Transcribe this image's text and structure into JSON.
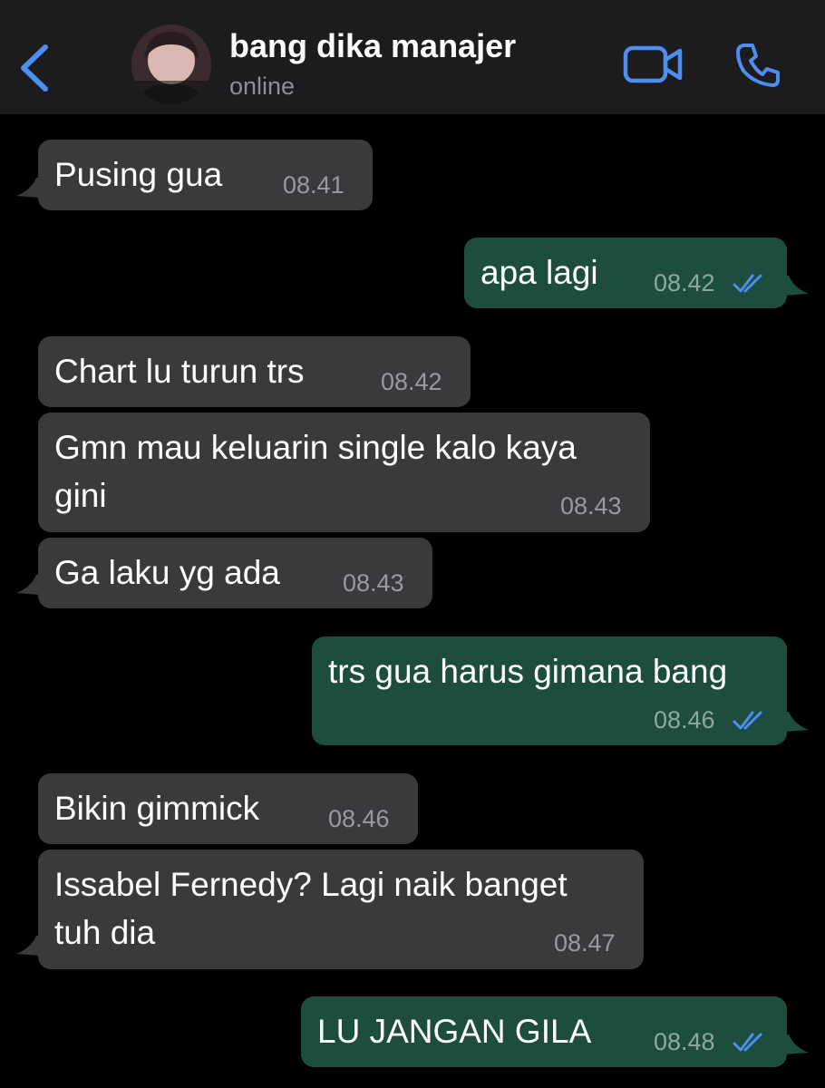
{
  "header": {
    "contact_name": "bang dika manajer",
    "contact_status": "online"
  },
  "colors": {
    "accent": "#4d8ef0",
    "incoming_bubble": "#3a3a3c",
    "outgoing_bubble": "#1d4d3e",
    "background": "#000000",
    "header_bg": "#1c1c1e"
  },
  "icons": {
    "back": "chevron-left-icon",
    "video": "video-camera-icon",
    "call": "phone-icon",
    "read_receipt": "double-check-icon"
  },
  "messages": [
    {
      "direction": "incoming",
      "text": "Pusing gua",
      "time": "08.41"
    },
    {
      "direction": "outgoing",
      "text": "apa lagi",
      "time": "08.42",
      "status": "read"
    },
    {
      "direction": "incoming",
      "text": "Chart lu turun trs",
      "time": "08.42"
    },
    {
      "direction": "incoming",
      "text_line1": "Gmn mau keluarin single kalo kaya",
      "text_line2": "gini",
      "time": "08.43"
    },
    {
      "direction": "incoming",
      "text": "Ga laku yg ada",
      "time": "08.43"
    },
    {
      "direction": "outgoing",
      "text": "trs gua harus gimana bang",
      "time": "08.46",
      "status": "read"
    },
    {
      "direction": "incoming",
      "text": "Bikin gimmick",
      "time": "08.46"
    },
    {
      "direction": "incoming",
      "text_line1": "Issabel Fernedy? Lagi naik banget",
      "text_line2": "tuh dia",
      "time": "08.47"
    },
    {
      "direction": "outgoing",
      "text": "LU JANGAN GILA",
      "time": "08.48",
      "status": "read"
    }
  ]
}
